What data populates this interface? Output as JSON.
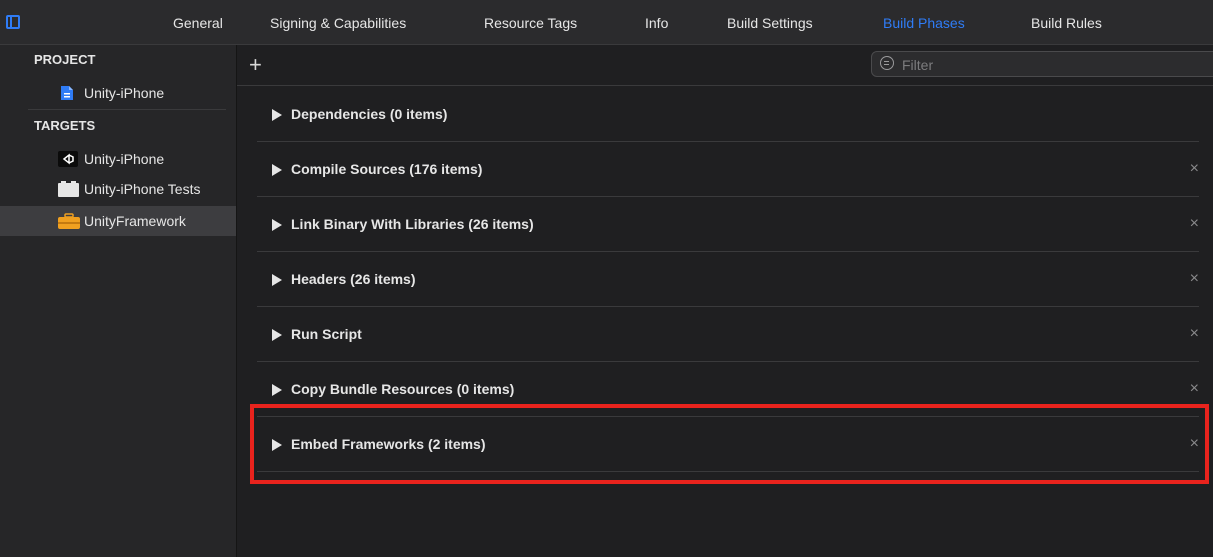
{
  "tabs": [
    "General",
    "Signing & Capabilities",
    "Resource Tags",
    "Info",
    "Build Settings",
    "Build Phases",
    "Build Rules"
  ],
  "active_tab": "Build Phases",
  "sidebar": {
    "project_header": "PROJECT",
    "project_item": "Unity-iPhone",
    "targets_header": "TARGETS",
    "targets": [
      "Unity-iPhone",
      "Unity-iPhone Tests",
      "UnityFramework"
    ],
    "selected_target": "UnityFramework"
  },
  "toolbar": {
    "add_label": "+",
    "filter_placeholder": "Filter"
  },
  "phases": [
    "Dependencies (0 items)",
    "Compile Sources (176 items)",
    "Link Binary With Libraries (26 items)",
    "Headers (26 items)",
    "Run Script",
    "Copy Bundle Resources (0 items)",
    "Embed Frameworks (2 items)"
  ],
  "close_glyph": "×",
  "colors": {
    "accent": "#2f7cf6",
    "highlight": "#e8231d"
  }
}
